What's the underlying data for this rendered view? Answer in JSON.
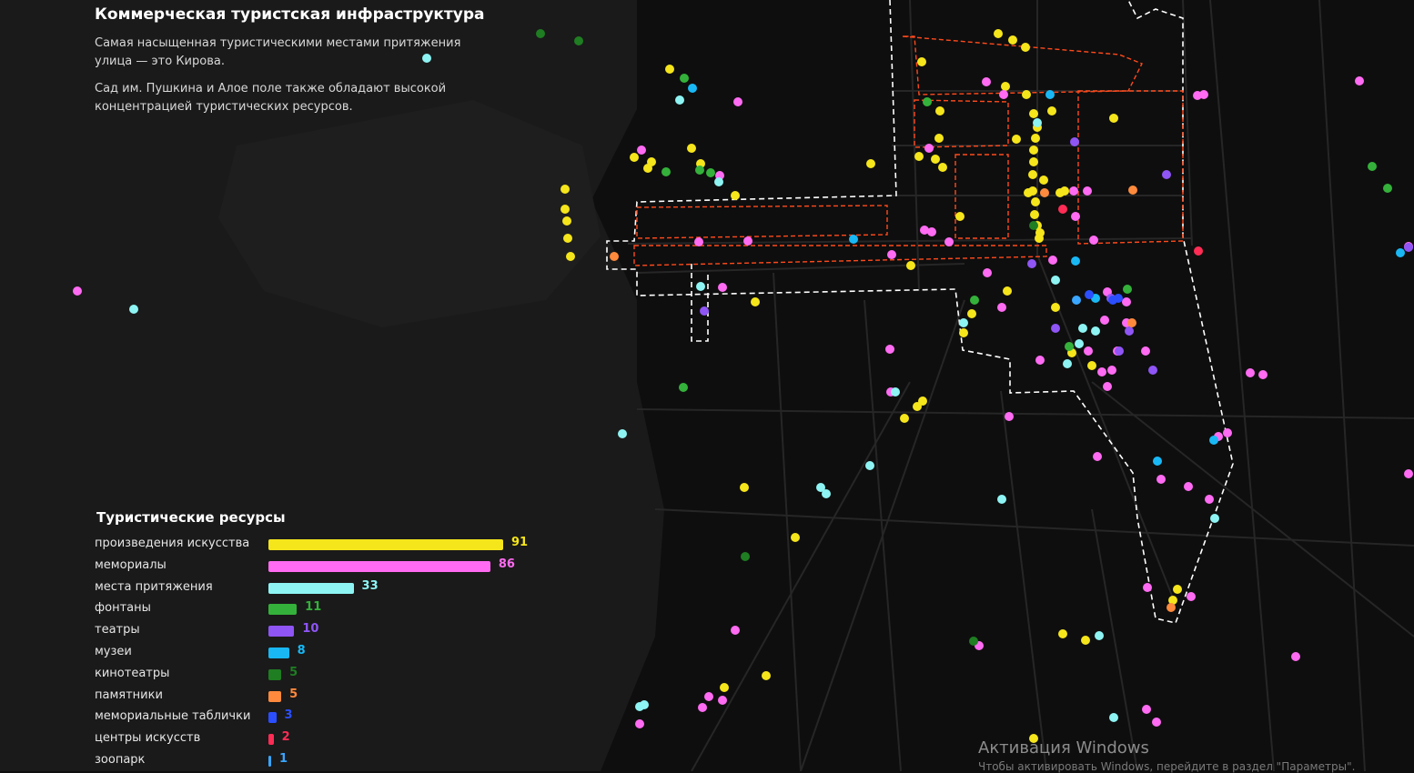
{
  "header": {
    "title": "Коммерческая туристская инфраструктура",
    "paragraph1": "Самая насыщенная туристическими местами притяжения улица — это Кирова.",
    "paragraph2": "Сад им. Пушкина и Алое поле также обладают высокой концентрацией туристических ресурсов."
  },
  "legend": {
    "title": "Туристические ресурсы",
    "max_value": 91,
    "items": [
      {
        "label": "произведения искусства",
        "value": 91,
        "color": "#f5e51b"
      },
      {
        "label": "мемориалы",
        "value": 86,
        "color": "#ff6bf2"
      },
      {
        "label": "места притяжения",
        "value": 33,
        "color": "#8ef3f3"
      },
      {
        "label": "фонтаны",
        "value": 11,
        "color": "#34b13a"
      },
      {
        "label": "театры",
        "value": 10,
        "color": "#8f55f5"
      },
      {
        "label": "музеи",
        "value": 8,
        "color": "#19b8f5"
      },
      {
        "label": "кинотеатры",
        "value": 5,
        "color": "#1f7d22"
      },
      {
        "label": "памятники",
        "value": 5,
        "color": "#ff8a3d"
      },
      {
        "label": "мемориальные таблички",
        "value": 3,
        "color": "#2b4fff"
      },
      {
        "label": "центры искусств",
        "value": 2,
        "color": "#ff2d55"
      },
      {
        "label": "зоопарк",
        "value": 1,
        "color": "#3aa6ff"
      }
    ]
  },
  "map": {
    "background_color": "#0e0e0e",
    "lake_color": "#1c1c1c",
    "street_color": "#2a2a2a",
    "zone_outline_color": "#ffffff",
    "street_outline_color": "#ff4a1c"
  },
  "watermark": {
    "line1": "Активация Windows",
    "line2": "Чтобы активировать Windows, перейдите в раздел \"Параметры\"."
  }
}
